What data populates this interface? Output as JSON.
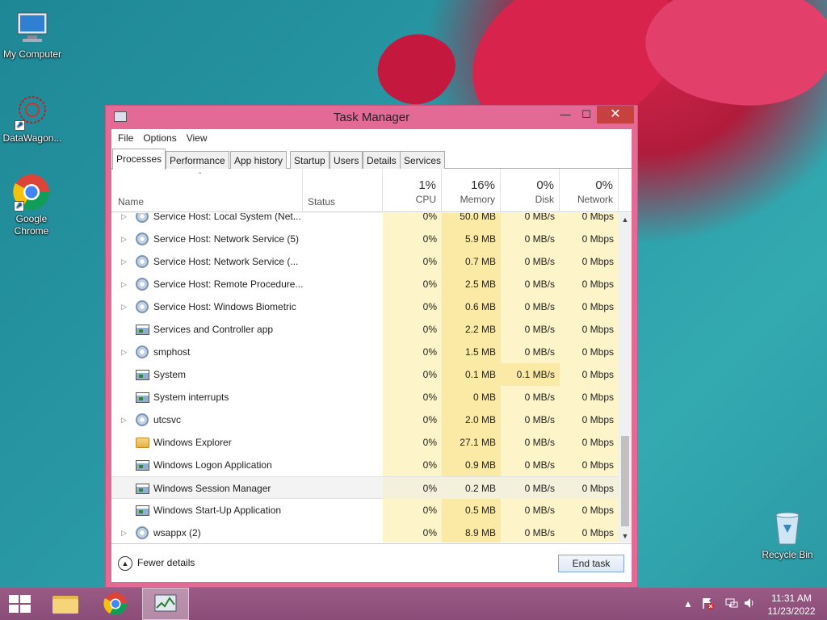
{
  "desktop": {
    "icons": [
      {
        "label": "My Computer",
        "icon": "my-computer-icon"
      },
      {
        "label": "DataWagon...",
        "icon": "datawagon-icon"
      },
      {
        "label": "Google Chrome",
        "icon": "chrome-icon"
      },
      {
        "label": "Recycle Bin",
        "icon": "recycle-bin-icon"
      }
    ]
  },
  "window": {
    "title": "Task Manager",
    "controls": {
      "minimize": "—",
      "maximize": "☐",
      "close": "✕"
    },
    "menu": [
      "File",
      "Options",
      "View"
    ],
    "tabs": [
      "Processes",
      "Performance",
      "App history",
      "Startup",
      "Users",
      "Details",
      "Services"
    ],
    "active_tab": "Processes",
    "columns": {
      "name": "Name",
      "status": "Status",
      "cpu": {
        "pct": "1%",
        "label": "CPU"
      },
      "memory": {
        "pct": "16%",
        "label": "Memory"
      },
      "disk": {
        "pct": "0%",
        "label": "Disk"
      },
      "network": {
        "pct": "0%",
        "label": "Network"
      }
    },
    "rows": [
      {
        "name": "Service Host: Local System (Net...",
        "icon": "gear-icon",
        "expand": true,
        "cpu": "0%",
        "memory": "50.0 MB",
        "disk": "0 MB/s",
        "network": "0 Mbps"
      },
      {
        "name": "Service Host: Network Service (5)",
        "icon": "gear-icon",
        "expand": true,
        "cpu": "0%",
        "memory": "5.9 MB",
        "disk": "0 MB/s",
        "network": "0 Mbps"
      },
      {
        "name": "Service Host: Network Service (...",
        "icon": "gear-icon",
        "expand": true,
        "cpu": "0%",
        "memory": "0.7 MB",
        "disk": "0 MB/s",
        "network": "0 Mbps"
      },
      {
        "name": "Service Host: Remote Procedure...",
        "icon": "gear-icon",
        "expand": true,
        "cpu": "0%",
        "memory": "2.5 MB",
        "disk": "0 MB/s",
        "network": "0 Mbps"
      },
      {
        "name": "Service Host: Windows Biometric",
        "icon": "gear-icon",
        "expand": true,
        "cpu": "0%",
        "memory": "0.6 MB",
        "disk": "0 MB/s",
        "network": "0 Mbps"
      },
      {
        "name": "Services and Controller app",
        "icon": "window-icon",
        "expand": false,
        "cpu": "0%",
        "memory": "2.2 MB",
        "disk": "0 MB/s",
        "network": "0 Mbps"
      },
      {
        "name": "smphost",
        "icon": "gear-icon",
        "expand": true,
        "cpu": "0%",
        "memory": "1.5 MB",
        "disk": "0 MB/s",
        "network": "0 Mbps"
      },
      {
        "name": "System",
        "icon": "window-icon",
        "expand": false,
        "cpu": "0%",
        "memory": "0.1 MB",
        "disk": "0.1 MB/s",
        "network": "0 Mbps"
      },
      {
        "name": "System interrupts",
        "icon": "window-icon",
        "expand": false,
        "cpu": "0%",
        "memory": "0 MB",
        "disk": "0 MB/s",
        "network": "0 Mbps"
      },
      {
        "name": "utcsvc",
        "icon": "gear-icon",
        "expand": true,
        "cpu": "0%",
        "memory": "2.0 MB",
        "disk": "0 MB/s",
        "network": "0 Mbps"
      },
      {
        "name": "Windows Explorer",
        "icon": "folder-icon",
        "expand": false,
        "cpu": "0%",
        "memory": "27.1 MB",
        "disk": "0 MB/s",
        "network": "0 Mbps"
      },
      {
        "name": "Windows Logon Application",
        "icon": "window-icon",
        "expand": false,
        "cpu": "0%",
        "memory": "0.9 MB",
        "disk": "0 MB/s",
        "network": "0 Mbps"
      },
      {
        "name": "Windows Session Manager",
        "icon": "window-icon",
        "expand": false,
        "cpu": "0%",
        "memory": "0.2 MB",
        "disk": "0 MB/s",
        "network": "0 Mbps",
        "selected": true
      },
      {
        "name": "Windows Start-Up Application",
        "icon": "window-icon",
        "expand": false,
        "cpu": "0%",
        "memory": "0.5 MB",
        "disk": "0 MB/s",
        "network": "0 Mbps"
      },
      {
        "name": "wsappx (2)",
        "icon": "gear-icon",
        "expand": true,
        "cpu": "0%",
        "memory": "8.9 MB",
        "disk": "0 MB/s",
        "network": "0 Mbps"
      }
    ],
    "footer": {
      "fewer_details": "Fewer details",
      "end_task": "End task"
    }
  },
  "taskbar": {
    "items": [
      "start-icon",
      "file-explorer-icon",
      "chrome-icon",
      "task-manager-icon"
    ],
    "tray": [
      "show-hidden-icons-icon",
      "action-center-flag-icon",
      "network-icon",
      "volume-icon"
    ],
    "clock": {
      "time": "11:31 AM",
      "date": "11/23/2022"
    }
  }
}
